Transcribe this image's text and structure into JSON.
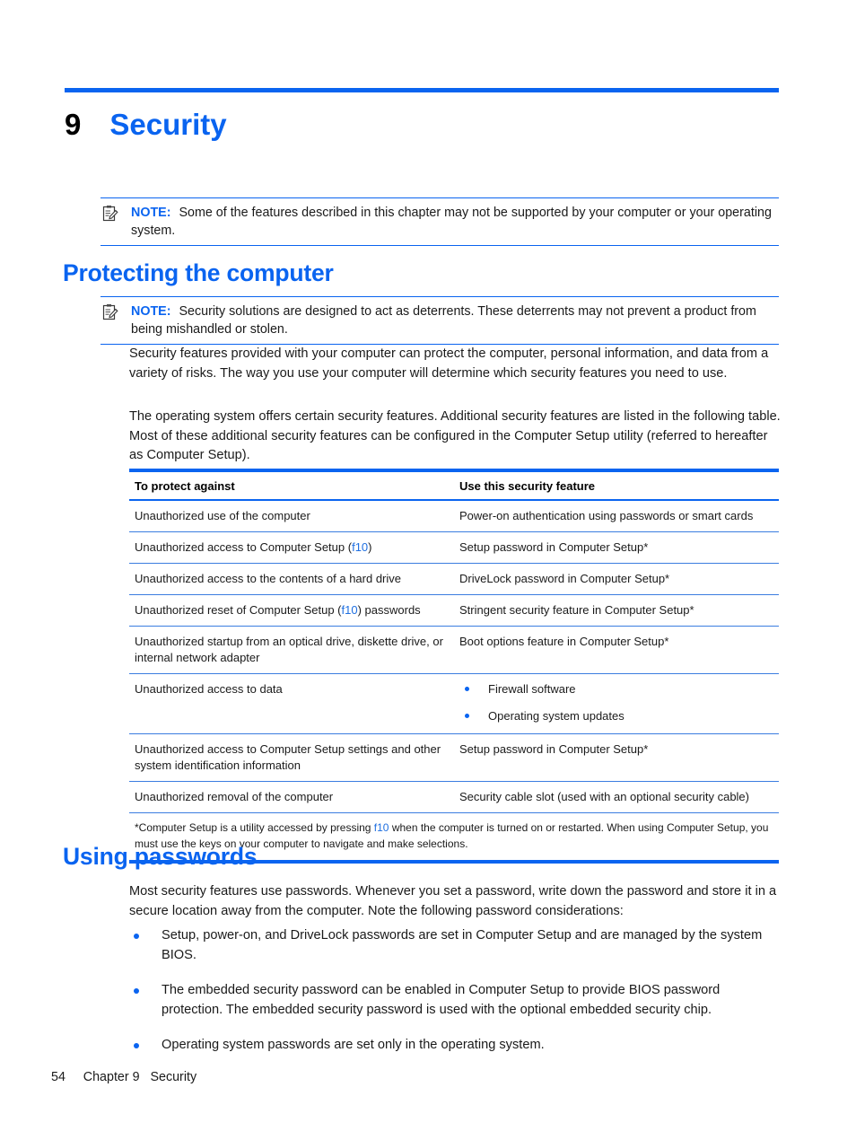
{
  "page": {
    "accent_color": "#0a64f0",
    "link_color": "#1f6fe0",
    "chapter_number": "9",
    "chapter_title": "Security"
  },
  "notes": [
    {
      "icon": "note-clipboard-icon",
      "label": "NOTE:",
      "text": "Some of the features described in this chapter may not be supported by your computer or your operating system."
    },
    {
      "icon": "note-clipboard-icon",
      "label": "NOTE:",
      "text": "Security solutions are designed to act as deterrents. These deterrents may not prevent a product from being mishandled or stolen."
    }
  ],
  "headings": {
    "protecting": "Protecting the computer",
    "using_passwords": "Using passwords"
  },
  "paragraphs": {
    "security_features": "Security features provided with your computer can protect the computer, personal information, and data from a variety of risks. The way you use your computer will determine which security features you need to use.",
    "operating_system": "The operating system offers certain security features. Additional security features are listed in the following table. Most of these additional security features can be configured in the Computer Setup utility (referred to hereafter as Computer Setup).",
    "most_security": "Most security features use passwords. Whenever you set a password, write down the password and store it in a secure location away from the computer. Note the following password considerations:"
  },
  "table": {
    "headers": [
      "To protect against",
      "Use this security feature"
    ],
    "rows": [
      {
        "protect_against": "Unauthorized use of the computer",
        "feature": "Power-on authentication using passwords or smart cards"
      },
      {
        "protect_against_pre": "Unauthorized access to Computer Setup (",
        "protect_against_link": "f10",
        "protect_against_post": ")",
        "feature": "Setup password in Computer Setup*"
      },
      {
        "protect_against": "Unauthorized access to the contents of a hard drive",
        "feature": "DriveLock password in Computer Setup*"
      },
      {
        "protect_against_pre": "Unauthorized reset of Computer Setup (",
        "protect_against_link": "f10",
        "protect_against_post": ") passwords",
        "feature": "Stringent security feature in Computer Setup*"
      },
      {
        "protect_against": "Unauthorized startup from an optical drive, diskette drive, or internal network adapter",
        "feature": "Boot options feature in Computer Setup*"
      },
      {
        "protect_against": "Unauthorized access to data",
        "feature_list": [
          "Firewall software",
          "Operating system updates"
        ]
      },
      {
        "protect_against": "Unauthorized access to Computer Setup settings and other system identification information",
        "feature": "Setup password in Computer Setup*"
      },
      {
        "protect_against": "Unauthorized removal of the computer",
        "feature": "Security cable slot (used with an optional security cable)"
      }
    ],
    "footnote_pre": "*Computer Setup is a utility accessed by pressing ",
    "footnote_link": "f10",
    "footnote_post": " when the computer is turned on or restarted. When using Computer Setup, you must use the keys on your computer to navigate and make selections."
  },
  "bullets": [
    "Setup, power-on, and DriveLock passwords are set in Computer Setup and are managed by the system BIOS.",
    "The embedded security password can be enabled in Computer Setup to provide BIOS password protection. The embedded security password is used with the optional embedded security chip.",
    "Operating system passwords are set only in the operating system."
  ],
  "footer": {
    "page_number": "54",
    "chapter_label": "Chapter 9",
    "chapter_name": "Security",
    "combined": "54     Chapter 9   Security"
  }
}
